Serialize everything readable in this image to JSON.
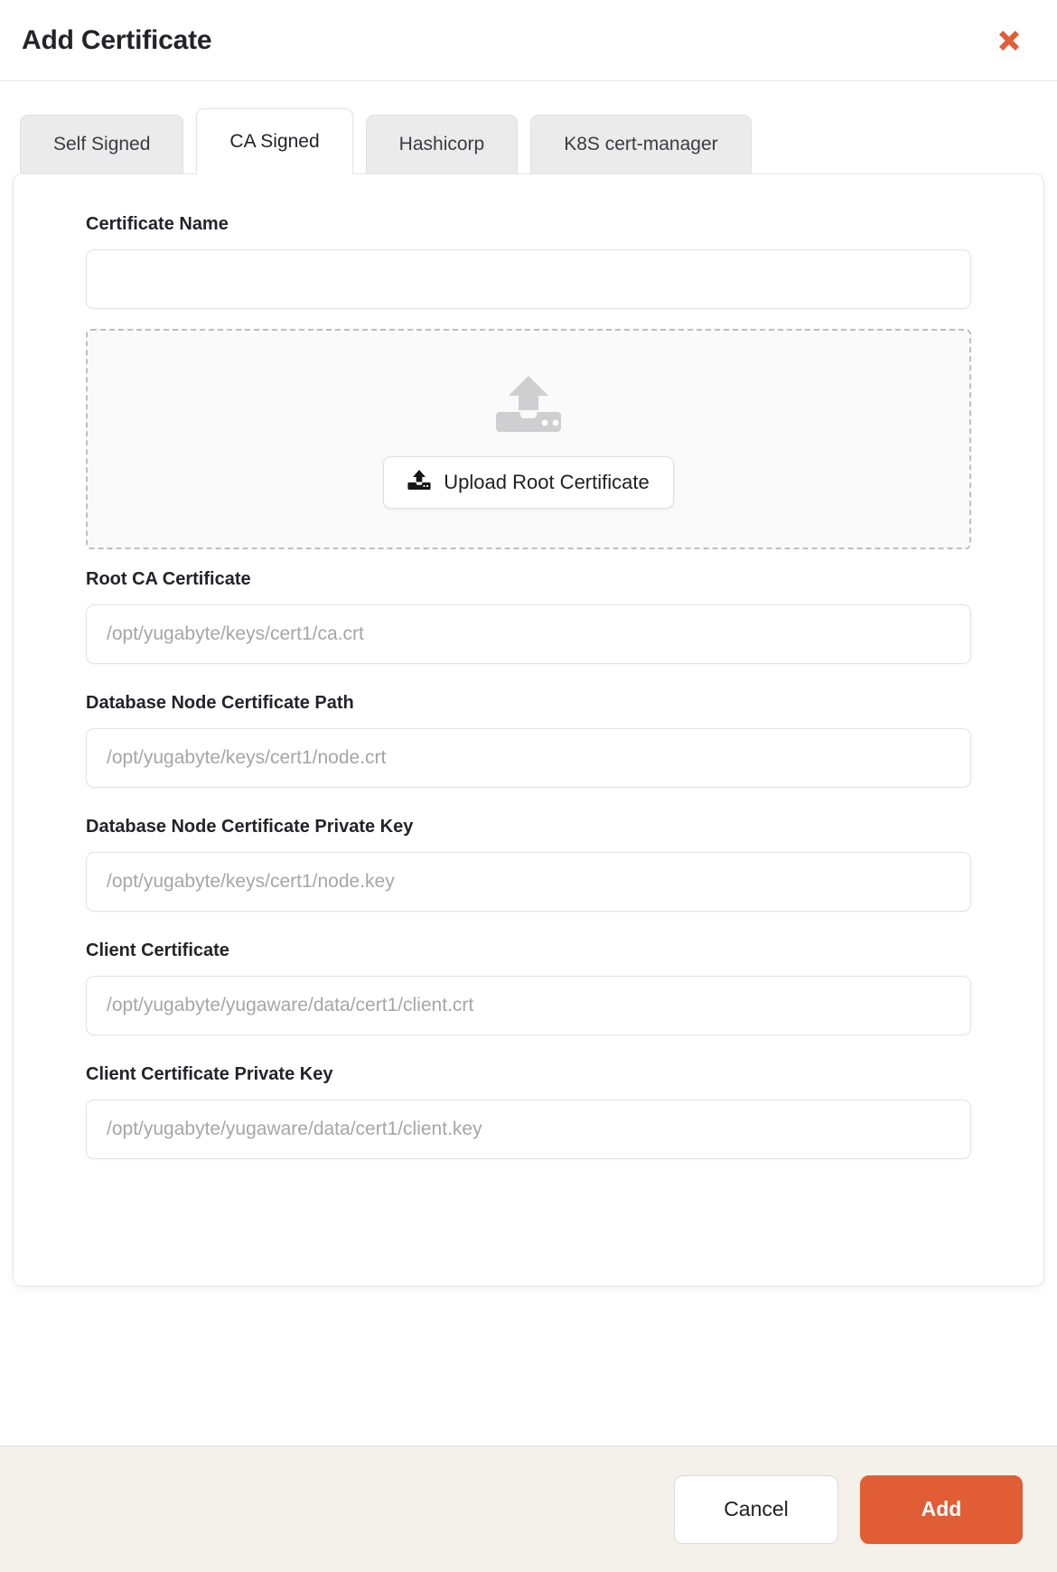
{
  "modal": {
    "title": "Add Certificate",
    "close_icon": "close-icon"
  },
  "tabs": [
    {
      "label": "Self Signed",
      "active": false
    },
    {
      "label": "CA Signed",
      "active": true
    },
    {
      "label": "Hashicorp",
      "active": false
    },
    {
      "label": "K8S cert-manager",
      "active": false
    }
  ],
  "form": {
    "certificate_name": {
      "label": "Certificate Name",
      "value": "",
      "placeholder": ""
    },
    "dropzone": {
      "icon": "upload-server-icon",
      "button_icon": "upload-icon",
      "button_label": "Upload Root Certificate"
    },
    "fields": [
      {
        "label": "Root CA Certificate",
        "placeholder": "/opt/yugabyte/keys/cert1/ca.crt",
        "value": ""
      },
      {
        "label": "Database Node Certificate Path",
        "placeholder": "/opt/yugabyte/keys/cert1/node.crt",
        "value": ""
      },
      {
        "label": "Database Node Certificate Private Key",
        "placeholder": "/opt/yugabyte/keys/cert1/node.key",
        "value": ""
      },
      {
        "label": "Client Certificate",
        "placeholder": "/opt/yugabyte/yugaware/data/cert1/client.crt",
        "value": ""
      },
      {
        "label": "Client Certificate Private Key",
        "placeholder": "/opt/yugabyte/yugaware/data/cert1/client.key",
        "value": ""
      }
    ]
  },
  "footer": {
    "cancel_label": "Cancel",
    "add_label": "Add"
  },
  "colors": {
    "accent": "#e05d36",
    "close": "#e05d36",
    "footer_bg": "#f4f1ea",
    "tab_inactive_bg": "#ebebeb",
    "placeholder": "#a6a6a6"
  }
}
